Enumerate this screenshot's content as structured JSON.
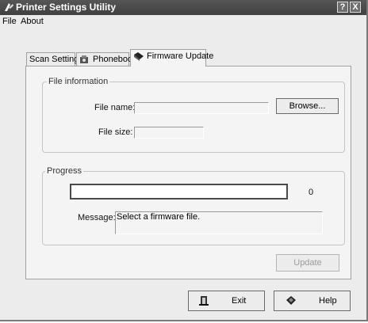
{
  "window": {
    "title": "Printer Settings Utility",
    "help_glyph": "?",
    "close_glyph": "X"
  },
  "menu": {
    "items": [
      "File",
      "About"
    ]
  },
  "tabs": [
    {
      "label": "Scan Settings",
      "icon": "none",
      "active": false
    },
    {
      "label": "Phonebook",
      "icon": "phonebook-icon",
      "active": false
    },
    {
      "label": "Firmware Update",
      "icon": "firmware-icon",
      "active": true
    }
  ],
  "file_info": {
    "group_label": "File information",
    "file_name_label": "File name:",
    "file_name_value": "",
    "browse_label": "Browse...",
    "file_size_label": "File size:",
    "file_size_value": ""
  },
  "progress": {
    "group_label": "Progress",
    "percent": 0,
    "percent_text": "0",
    "message_label": "Message:",
    "message_text": "Select a firmware file."
  },
  "update_label": "Update",
  "footer": {
    "exit_label": "Exit",
    "help_label": "Help"
  }
}
